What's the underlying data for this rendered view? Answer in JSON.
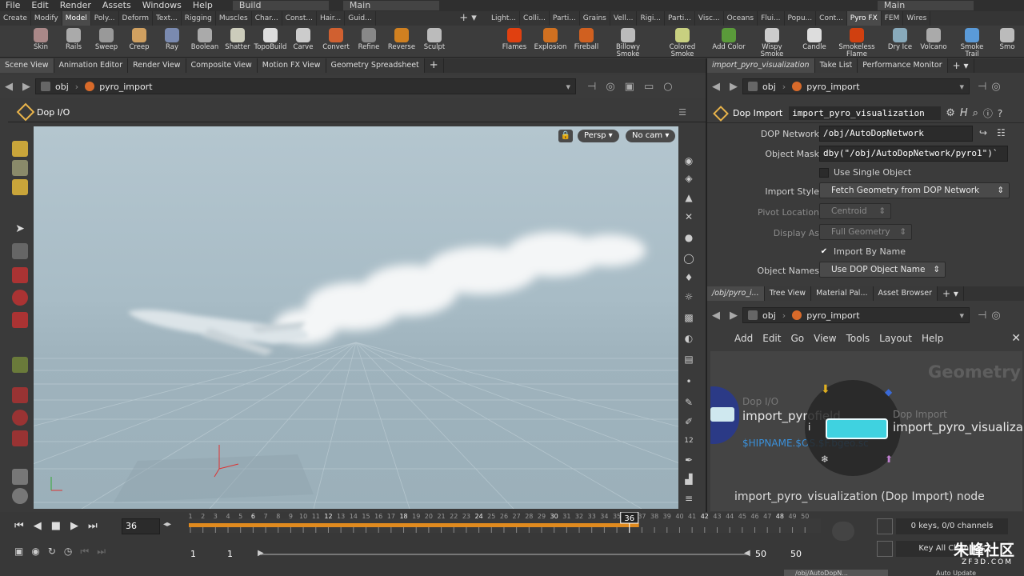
{
  "menubar": {
    "items": [
      "File",
      "Edit",
      "Render",
      "Assets",
      "Windows",
      "Help"
    ],
    "desktop": "Build",
    "workspace": "Main",
    "right_workspace": "Main"
  },
  "shelf_tabs_left": [
    "Create",
    "Modify",
    "Model",
    "Poly...",
    "Deform",
    "Text...",
    "Rigging",
    "Muscles",
    "Char...",
    "Const...",
    "Hair...",
    "Guid..."
  ],
  "shelf_tabs_right": [
    "Light...",
    "Colli...",
    "Parti...",
    "Grains",
    "Vell...",
    "Rigi...",
    "Parti...",
    "Visc...",
    "Oceans",
    "Flui...",
    "Popu...",
    "Cont...",
    "Pyro FX",
    "FEM",
    "Wires"
  ],
  "shelf_tools_left": [
    "Skin",
    "Rails",
    "Sweep",
    "Creep",
    "Ray",
    "Boolean",
    "Shatter",
    "TopoBuild",
    "Carve",
    "Convert",
    "Refine",
    "Reverse",
    "Sculpt"
  ],
  "shelf_tools_right": [
    "Flames",
    "Explosion",
    "Fireball",
    "Billowy Smoke",
    "Colored Smoke",
    "Add Color",
    "Wispy Smoke",
    "Candle",
    "Smokeless Flame",
    "Dry Ice",
    "Volcano",
    "Smoke Trail",
    "Smo"
  ],
  "pane_tabs_left": [
    "Scene View",
    "Animation Editor",
    "Render View",
    "Composite View",
    "Motion FX View",
    "Geometry Spreadsheet"
  ],
  "path": {
    "root": "obj",
    "node": "pyro_import"
  },
  "viewport": {
    "node_label": "Dop I/O",
    "persp": "Persp",
    "cam": "No cam"
  },
  "right_top_tabs": [
    "import_pyro_visualization",
    "Take List",
    "Performance Monitor"
  ],
  "param_header": {
    "type": "Dop Import",
    "name": "import_pyro_visualization"
  },
  "params": {
    "dop_network_label": "DOP Network",
    "dop_network_value": "/obj/AutoDopNetwork",
    "object_mask_label": "Object Mask",
    "object_mask_value": "dby(\"/obj/AutoDopNetwork/pyro1\")`",
    "use_single_object": "Use Single Object",
    "import_style_label": "Import Style",
    "import_style_value": "Fetch Geometry from DOP Network",
    "pivot_location_label": "Pivot Location",
    "pivot_location_value": "Centroid",
    "display_as_label": "Display As",
    "display_as_value": "Full Geometry",
    "import_by_name": "Import By Name",
    "object_names_label": "Object Names",
    "object_names_value": "Use DOP Object Name"
  },
  "right_bottom_tabs": [
    "/obj/pyro_i...",
    "Tree View",
    "Material Pal...",
    "Asset Browser"
  ],
  "network_menu": [
    "Add",
    "Edit",
    "Go",
    "View",
    "Tools",
    "Layout",
    "Help"
  ],
  "network": {
    "context_label": "Geometry",
    "node1_type": "Dop I/O",
    "node1_name": "import_pyrofield",
    "node1_sub": "$HIPNAME.$OS.$F.bgeo.sc",
    "node2_type": "Dop Import",
    "node2_name": "import_pyro_visualizat",
    "status": "import_pyro_visualization (Dop Import) node"
  },
  "timeline": {
    "current_frame": "36",
    "frame_marker": "36",
    "start": "1",
    "start2": "1",
    "end": "50",
    "end2": "50",
    "keys": "0 keys, 0/0 channels",
    "key_all": "Key All Channels",
    "ticks": [
      "1",
      "2",
      "3",
      "4",
      "5",
      "6",
      "7",
      "8",
      "9",
      "10",
      "11",
      "12",
      "13",
      "14",
      "15",
      "16",
      "17",
      "18",
      "19",
      "20",
      "21",
      "22",
      "23",
      "24",
      "25",
      "26",
      "27",
      "28",
      "29",
      "30",
      "31",
      "32",
      "33",
      "34",
      "35",
      "36",
      "37",
      "38",
      "39",
      "40",
      "41",
      "42",
      "43",
      "44",
      "45",
      "46",
      "47",
      "48",
      "49",
      "50"
    ],
    "cached_frames": 36,
    "status_path": "/obj/AutoDopN...",
    "auto_update": "Auto Update"
  },
  "watermark": {
    "cn": "朱峰社区",
    "url": "ZF3D.COM"
  },
  "colors": {
    "accent": "#e08a1e",
    "node_select": "#3fd2e0",
    "panel": "#3b3b3b"
  }
}
